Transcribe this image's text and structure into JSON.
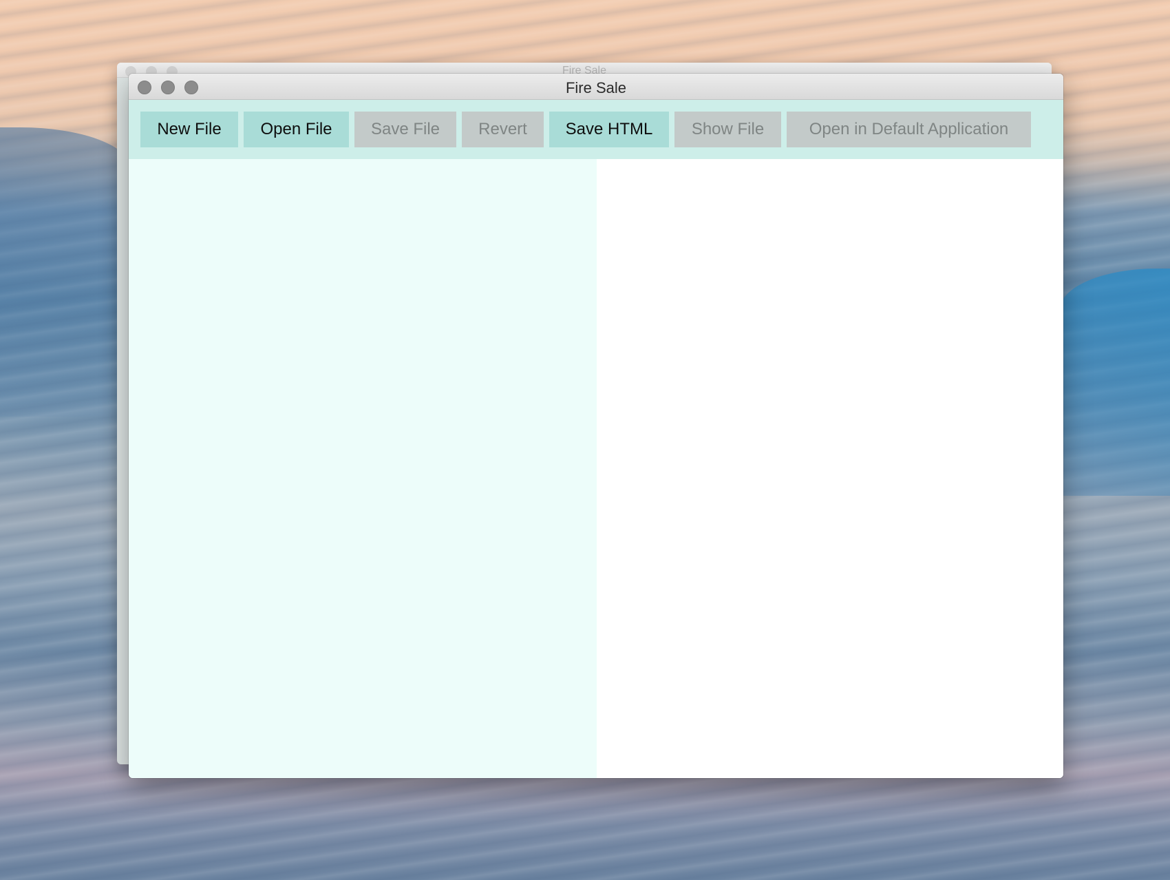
{
  "window": {
    "title": "Fire Sale"
  },
  "background_window": {
    "title": "Fire Sale"
  },
  "toolbar": {
    "buttons": [
      {
        "label": "New File",
        "enabled": true
      },
      {
        "label": "Open File",
        "enabled": true
      },
      {
        "label": "Save File",
        "enabled": false
      },
      {
        "label": "Revert",
        "enabled": false
      },
      {
        "label": "Save HTML",
        "enabled": true
      },
      {
        "label": "Show File",
        "enabled": false
      },
      {
        "label": "Open in Default Application",
        "enabled": false
      }
    ]
  },
  "panes": {
    "markdown_value": "",
    "html_value": ""
  },
  "colors": {
    "toolbar_bg": "#cdeee9",
    "button_enabled": "#a9dcd7",
    "button_disabled": "#c3cac9",
    "markdown_pane_bg": "#edfdfa",
    "html_pane_bg": "#ffffff",
    "traffic_light_inactive": "#8c8c8c"
  },
  "icons": {
    "close": "close-light-icon",
    "minimize": "minimize-light-icon",
    "zoom": "zoom-light-icon"
  }
}
